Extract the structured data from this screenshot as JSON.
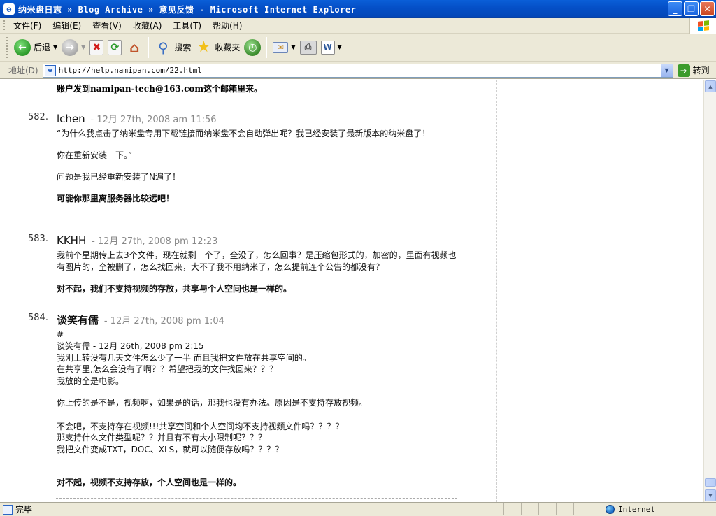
{
  "window": {
    "title": "纳米盘日志 » Blog Archive » 意见反馈 - Microsoft Internet Explorer",
    "minimize": "_",
    "maximize": "❐",
    "close": "✕"
  },
  "menu": [
    "文件(F)",
    "编辑(E)",
    "查看(V)",
    "收藏(A)",
    "工具(T)",
    "帮助(H)"
  ],
  "toolbar": {
    "back_label": "后退",
    "search_label": "搜索",
    "favorites_label": "收藏夹"
  },
  "address": {
    "label": "地址(D)",
    "url": "http://help.namipan.com/22.html",
    "go_label": "转到"
  },
  "content": {
    "top_fragment": "账户发到namipan-tech@163.com这个邮箱里来。",
    "comments": [
      {
        "number": "582.",
        "author": "lchen",
        "meta": "- 12月 27th, 2008 am 11:56",
        "body": [
          "“为什么我点击了纳米盘专用下载链接而纳米盘不会自动弹出呢？我已经安装了最新版本的纳米盘了！",
          "你在重新安装一下。”",
          "问题是我已经重新安装了N遍了！"
        ],
        "reply": "可能你那里离服务器比较远吧！"
      },
      {
        "number": "583.",
        "author": "KKHH",
        "meta": "- 12月 27th, 2008 pm 12:23",
        "body": [
          "我前个星期传上去3个文件，现在就剩一个了，全没了，怎么回事？是压缩包形式的，加密的，里面有视频也有图片的，全被删了，怎么找回来，大不了我不用纳米了，怎么提前连个公告的都没有？"
        ],
        "reply": "对不起，我们不支持视频的存放，共享与个人空间也是一样的。"
      },
      {
        "number": "584.",
        "author": "谈笑有儒",
        "meta": "- 12月 27th, 2008 pm 1:04",
        "body": [
          "#",
          "谈笑有儒 - 12月 26th, 2008 pm 2:15",
          "我刚上转没有几天文件怎么少了一半 而且我把文件放在共享空间的。",
          "在共享里,怎么会没有了啊？？希望把我的文件找回来？？？",
          "我放的全是电影。",
          "你上传的是不是，视频啊，如果是的话，那我也没有办法。原因是不支持存放视频。",
          "————————————————————————————-",
          "不会吧，不支持存在视频!!!共享空间和个人空间均不支持视频文件吗？？？？",
          "那支持什么文件类型呢？？并且有不有大小限制呢？？？",
          "我把文件变成TXT，DOC、XLS，就可以随便存放吗？？？？"
        ],
        "reply": "对不起，视频不支持存放，个人空间也是一样的。"
      }
    ]
  },
  "status": {
    "text": "完毕",
    "zone": "Internet"
  }
}
